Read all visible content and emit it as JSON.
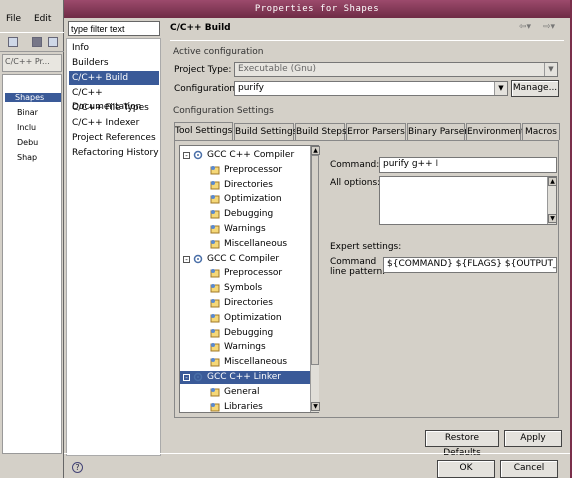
{
  "bg_app": {
    "menu": [
      "File",
      "Edit"
    ],
    "panel_tab": "C/C++ Pr...",
    "tree": [
      {
        "label": "Shapes",
        "selected": true
      },
      {
        "label": "Binar"
      },
      {
        "label": "Inclu"
      },
      {
        "label": "Debu"
      },
      {
        "label": "Shap"
      }
    ]
  },
  "dialog": {
    "title": "Properties for Shapes",
    "filter_placeholder": "type filter text",
    "nav": [
      "Info",
      "Builders",
      "C/C++ Build",
      "C/C++ Documentation",
      "C/C++ File Types",
      "C/C++ Indexer",
      "Project References",
      "Refactoring History"
    ],
    "nav_selected": 2,
    "page_title": "C/C++ Build",
    "active_config_label": "Active configuration",
    "project_type_label": "Project Type:",
    "project_type_value": "Executable (Gnu)",
    "configuration_label": "Configuration:",
    "configuration_value": "purify",
    "manage_label": "Manage...",
    "config_settings_label": "Configuration Settings",
    "tabs": [
      "Tool Settings",
      "Build Settings",
      "Build Steps",
      "Error Parsers",
      "Binary Parser",
      "Environment",
      "Macros"
    ],
    "active_tab": 0,
    "tool_tree": [
      {
        "label": "GCC C++ Compiler",
        "level": 0,
        "expander": "-"
      },
      {
        "label": "Preprocessor",
        "level": 1
      },
      {
        "label": "Directories",
        "level": 1
      },
      {
        "label": "Optimization",
        "level": 1
      },
      {
        "label": "Debugging",
        "level": 1
      },
      {
        "label": "Warnings",
        "level": 1
      },
      {
        "label": "Miscellaneous",
        "level": 1
      },
      {
        "label": "GCC C Compiler",
        "level": 0,
        "expander": "-"
      },
      {
        "label": "Preprocessor",
        "level": 1
      },
      {
        "label": "Symbols",
        "level": 1
      },
      {
        "label": "Directories",
        "level": 1
      },
      {
        "label": "Optimization",
        "level": 1
      },
      {
        "label": "Debugging",
        "level": 1
      },
      {
        "label": "Warnings",
        "level": 1
      },
      {
        "label": "Miscellaneous",
        "level": 1
      },
      {
        "label": "GCC C++ Linker",
        "level": 0,
        "expander": "-",
        "selected": true
      },
      {
        "label": "General",
        "level": 1
      },
      {
        "label": "Libraries",
        "level": 1
      }
    ],
    "command_label": "Command:",
    "command_value": "purify g++",
    "all_options_label": "All options:",
    "expert_label": "Expert settings:",
    "cmd_pattern_label_1": "Command",
    "cmd_pattern_label_2": "line pattern:",
    "cmd_pattern_value": "${COMMAND} ${FLAGS} ${OUTPUT_FLA",
    "restore_label": "Restore Defaults",
    "apply_label": "Apply",
    "ok_label": "OK",
    "cancel_label": "Cancel",
    "help_glyph": "?"
  },
  "colors": {
    "selection": "#3a5a98",
    "titlebar": "#7a2f4b",
    "dialog_bg": "#d4d0c8"
  }
}
